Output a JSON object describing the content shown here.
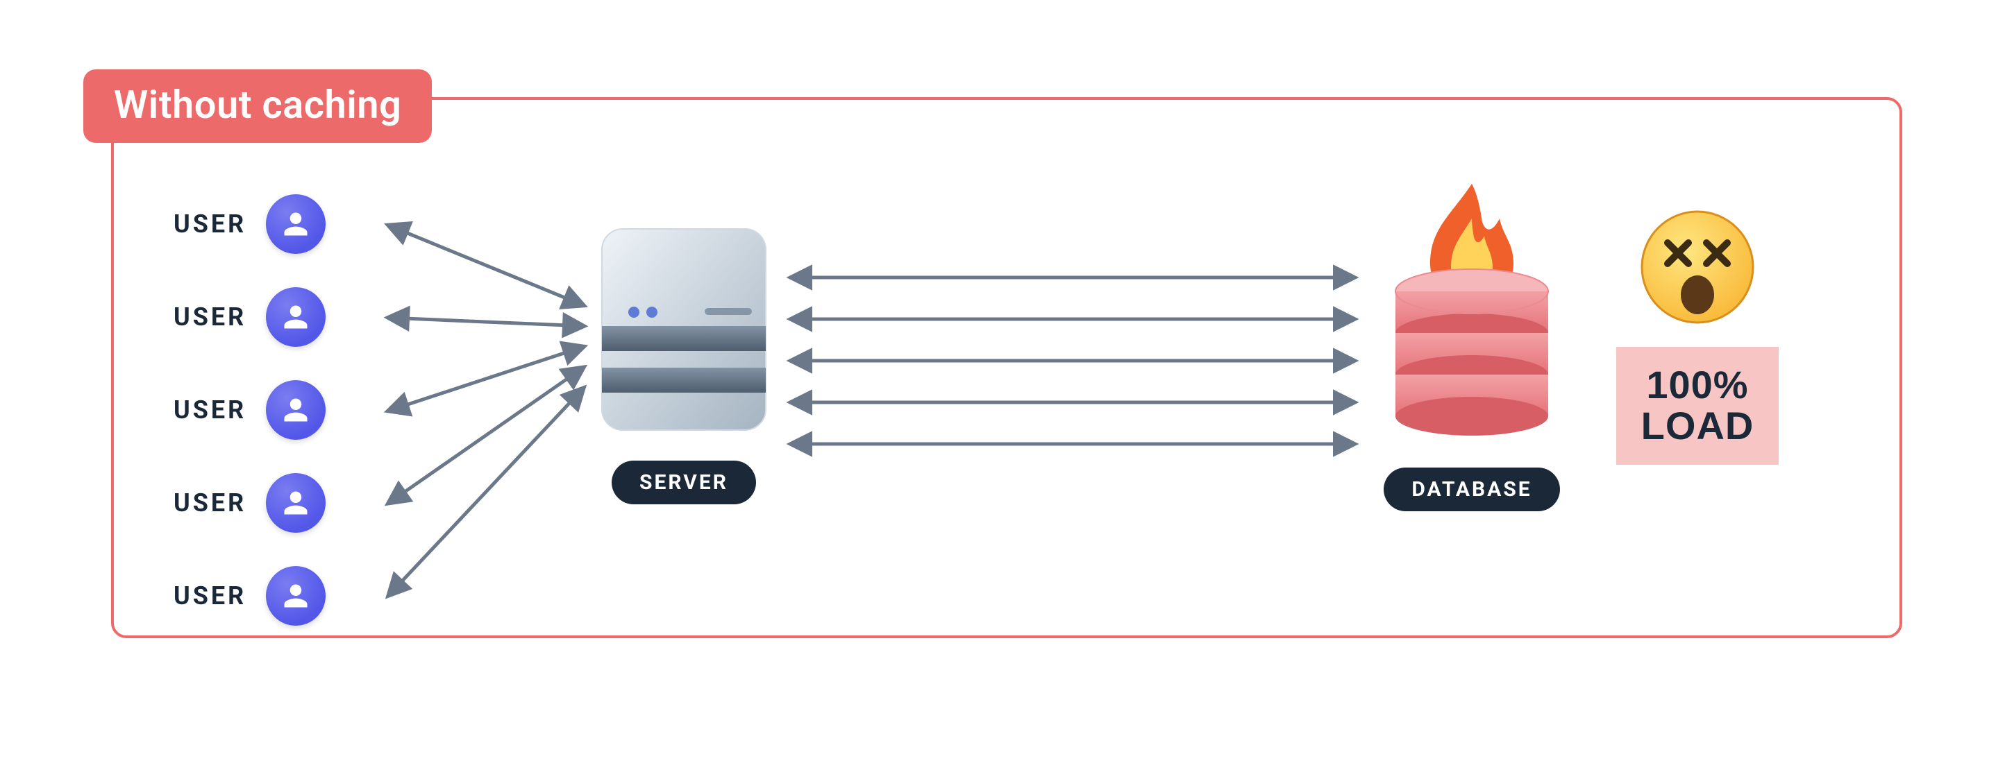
{
  "title": "Without caching",
  "users": [
    {
      "label": "USER"
    },
    {
      "label": "USER"
    },
    {
      "label": "USER"
    },
    {
      "label": "USER"
    },
    {
      "label": "USER"
    }
  ],
  "server": {
    "label": "SERVER"
  },
  "database": {
    "label": "DATABASE"
  },
  "load": {
    "line1": "100%",
    "line2": "LOAD"
  },
  "colors": {
    "accent": "#ed6a6a",
    "arrow": "#6b7889",
    "dark_pill": "#1b2838",
    "user_avatar": "#5257e8",
    "db_fill": "#ea888d",
    "fire_outer": "#f0602a",
    "fire_inner": "#ffd25a"
  }
}
